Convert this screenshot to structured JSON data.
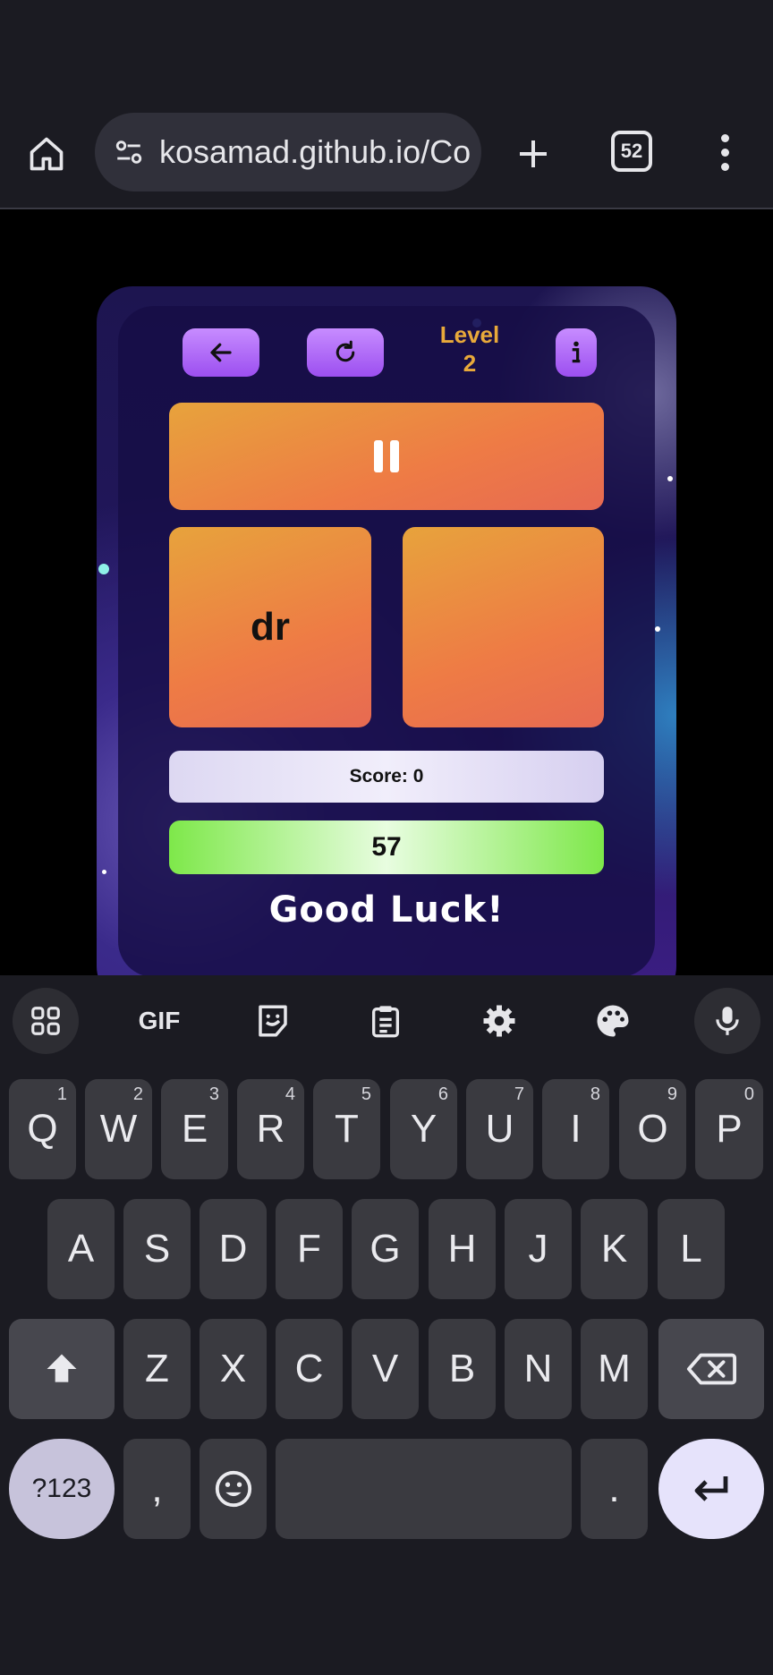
{
  "browser": {
    "url": "kosamad.github.io/Co",
    "tab_count": "52"
  },
  "game": {
    "level_label": "Level",
    "level_number": "2",
    "left_tile_text": "dr",
    "right_tile_text": "",
    "score_text": "Score: 0",
    "timer_value": "57",
    "message": "Good Luck!"
  },
  "keyboard": {
    "tools": [
      "apps-icon",
      "GIF",
      "sticker-icon",
      "clipboard-icon",
      "settings-icon",
      "palette-icon",
      "mic-icon"
    ],
    "gif_label": "GIF",
    "row1": [
      {
        "k": "Q",
        "h": "1"
      },
      {
        "k": "W",
        "h": "2"
      },
      {
        "k": "E",
        "h": "3"
      },
      {
        "k": "R",
        "h": "4"
      },
      {
        "k": "T",
        "h": "5"
      },
      {
        "k": "Y",
        "h": "6"
      },
      {
        "k": "U",
        "h": "7"
      },
      {
        "k": "I",
        "h": "8"
      },
      {
        "k": "O",
        "h": "9"
      },
      {
        "k": "P",
        "h": "0"
      }
    ],
    "row2": [
      "A",
      "S",
      "D",
      "F",
      "G",
      "H",
      "J",
      "K",
      "L"
    ],
    "row3": [
      "Z",
      "X",
      "C",
      "V",
      "B",
      "N",
      "M"
    ],
    "symbols_label": "?123",
    "comma_label": ",",
    "period_label": "."
  }
}
